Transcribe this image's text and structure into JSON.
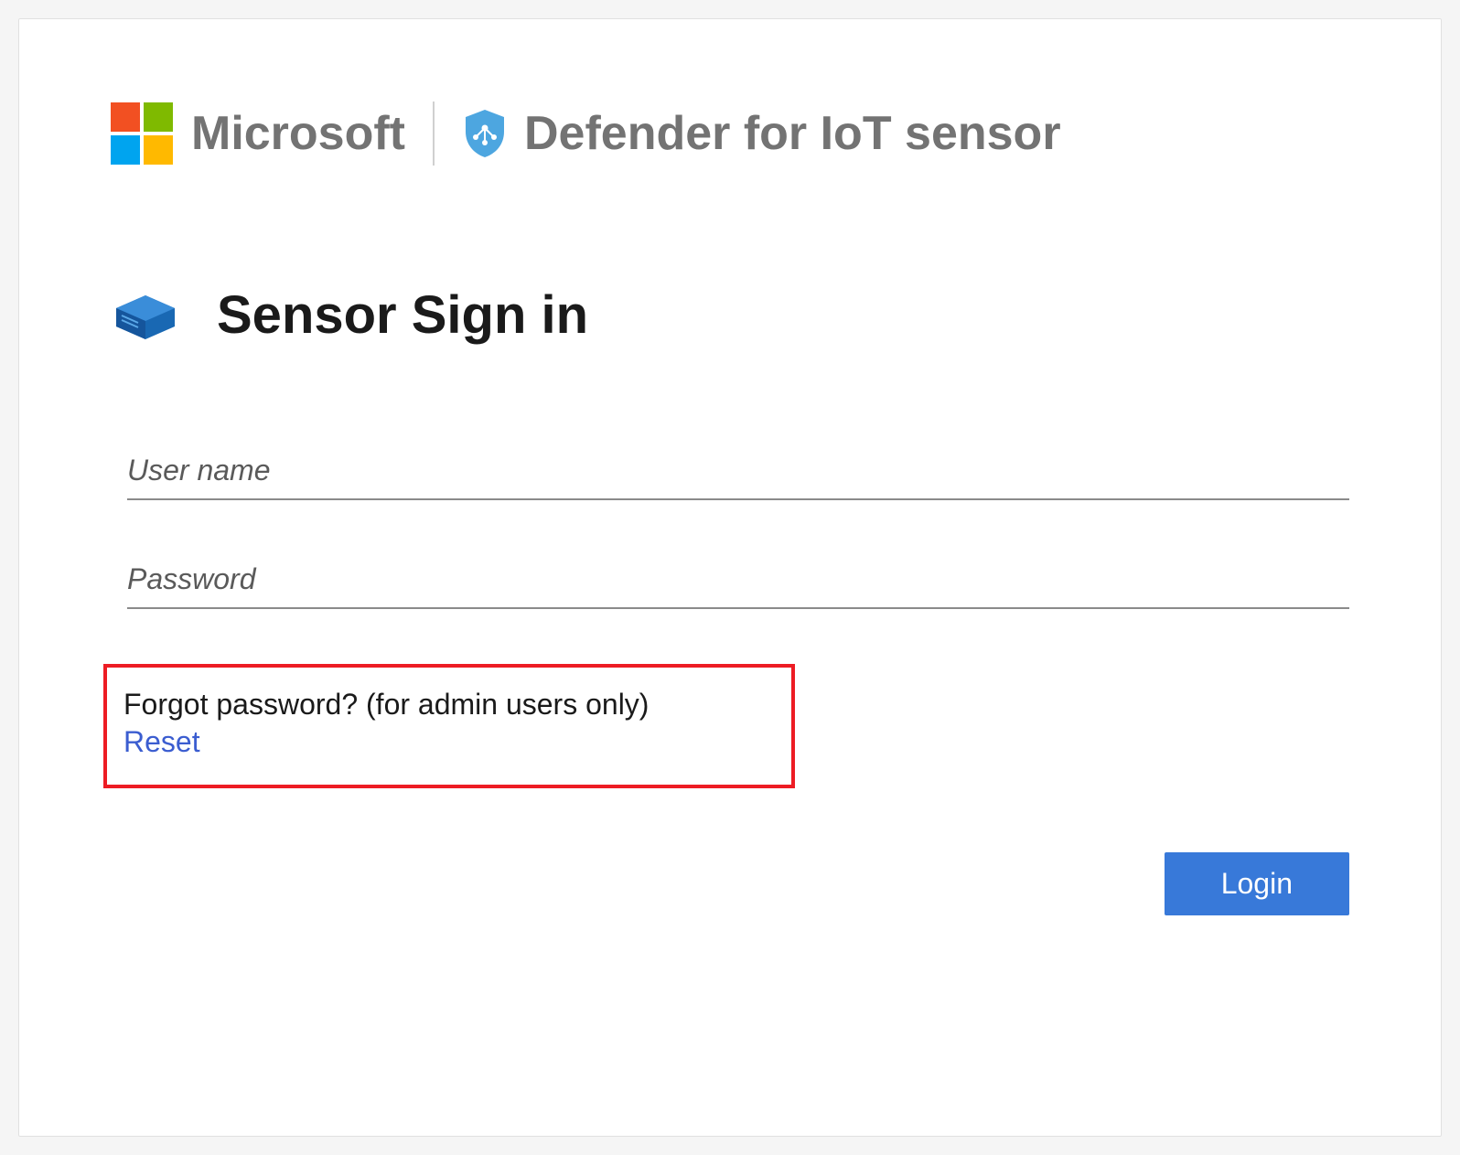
{
  "header": {
    "company": "Microsoft",
    "product": "Defender for IoT sensor"
  },
  "signin": {
    "title": "Sensor Sign in"
  },
  "form": {
    "username_placeholder": "User name",
    "password_placeholder": "Password"
  },
  "forgot": {
    "question": "Forgot password? (for admin users only)",
    "reset_label": "Reset"
  },
  "actions": {
    "login_label": "Login"
  }
}
